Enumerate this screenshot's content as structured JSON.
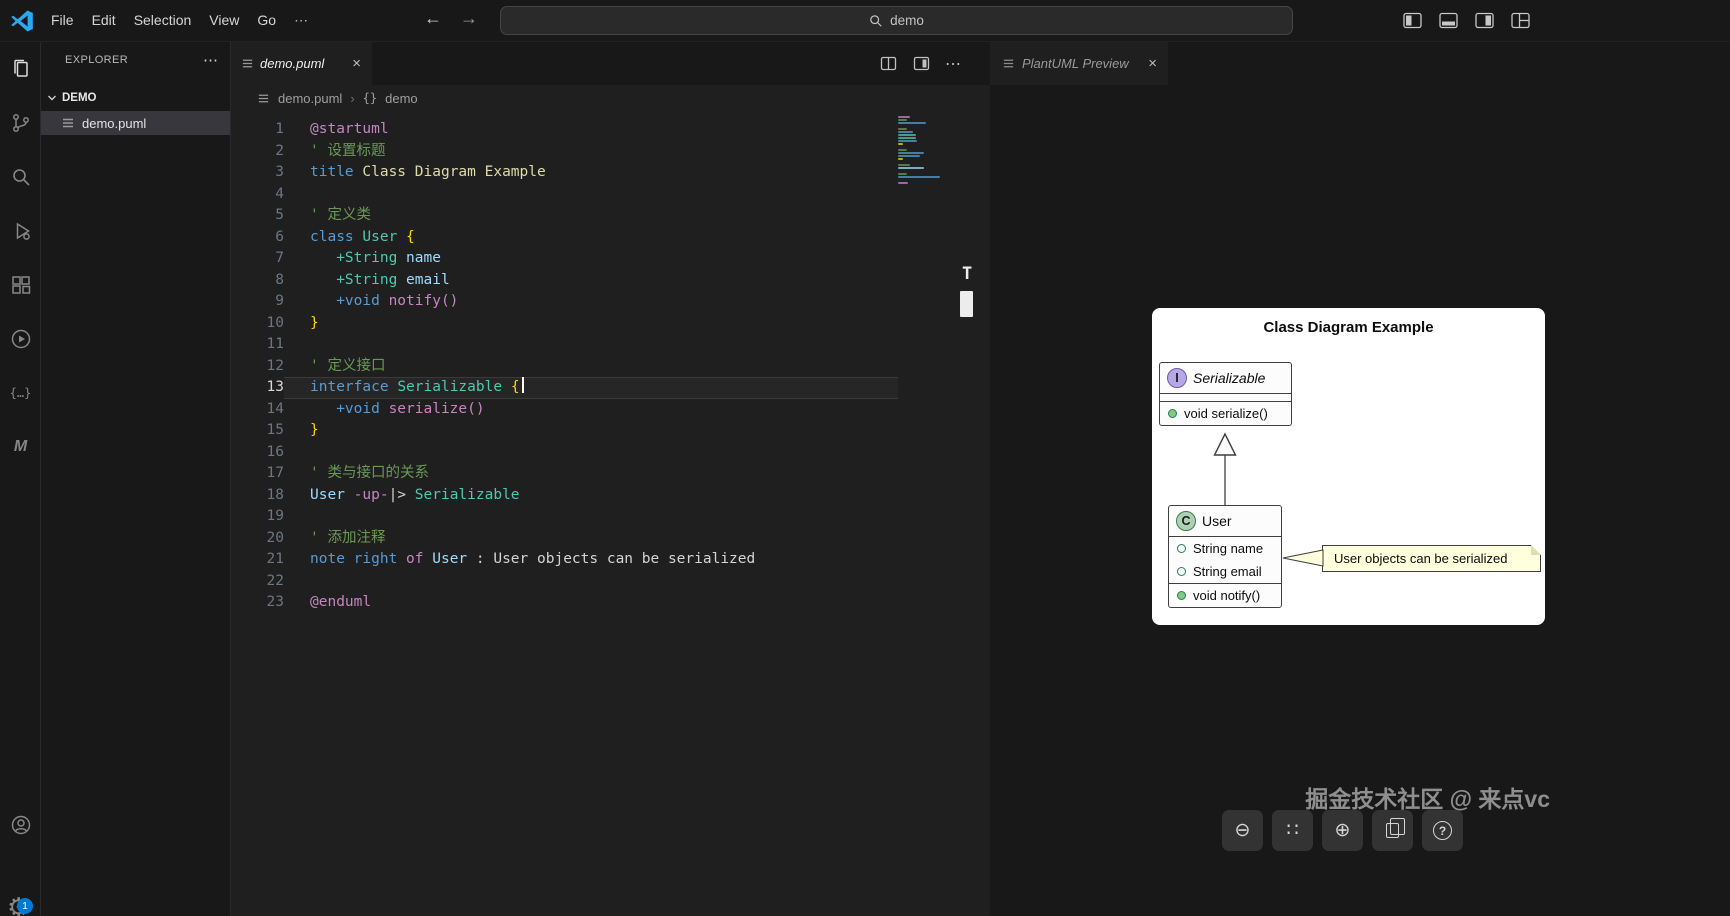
{
  "titlebar": {
    "menus": [
      "File",
      "Edit",
      "Selection",
      "View",
      "Go"
    ],
    "more_glyph": "⋯",
    "back_glyph": "←",
    "forward_glyph": "→",
    "search": {
      "value": "demo"
    },
    "window_icons": [
      "toggle-primary-sidebar",
      "toggle-panel",
      "toggle-secondary-sidebar",
      "customize-layout"
    ]
  },
  "activity_bar": {
    "items": [
      "explorer",
      "source-control",
      "search",
      "run-and-debug",
      "extensions",
      "run-circle",
      "snippets-braces",
      "plantuml-m"
    ],
    "braces_glyph": "{…}",
    "m_glyph": "M",
    "settings_glyph": "⚙",
    "badge": "1"
  },
  "explorer": {
    "title": "EXPLORER",
    "more_glyph": "⋯",
    "section": "DEMO",
    "files": [
      {
        "name": "demo.puml"
      }
    ]
  },
  "editor_group": {
    "tab": {
      "label": "demo.puml",
      "close_glyph": "×"
    },
    "actions_more_glyph": "⋯",
    "breadcrumb": {
      "file": "demo.puml",
      "separator": "›",
      "symbol_glyph": "{}",
      "symbol_name": "demo"
    },
    "overlay_letter": "T"
  },
  "editor": {
    "active_line": 13,
    "token_colors": {
      "pk": "#C586C0",
      "cm": "#6A9955",
      "kw": "#569CD6",
      "ti": "#DCDCAA",
      "ty": "#4EC9B0",
      "vr": "#9CDCFE",
      "fn": "#C586C0",
      "br": "#FFD700",
      "tx": "#D4D4D4"
    },
    "lines": [
      {
        "num": 1,
        "tokens": [
          [
            "pk",
            "@startuml"
          ]
        ]
      },
      {
        "num": 2,
        "tokens": [
          [
            "cm",
            "' 设置标题"
          ]
        ]
      },
      {
        "num": 3,
        "tokens": [
          [
            "kw",
            "title "
          ],
          [
            "ti",
            "Class Diagram Example"
          ]
        ]
      },
      {
        "num": 4,
        "tokens": []
      },
      {
        "num": 5,
        "tokens": [
          [
            "cm",
            "' 定义类"
          ]
        ]
      },
      {
        "num": 6,
        "tokens": [
          [
            "kw",
            "class "
          ],
          [
            "ty",
            "User "
          ],
          [
            "br",
            "{"
          ]
        ]
      },
      {
        "num": 7,
        "tokens": [
          [
            "ty",
            "   +String "
          ],
          [
            "vr",
            "name"
          ]
        ]
      },
      {
        "num": 8,
        "tokens": [
          [
            "ty",
            "   +String "
          ],
          [
            "vr",
            "email"
          ]
        ]
      },
      {
        "num": 9,
        "tokens": [
          [
            "kw",
            "   +void "
          ],
          [
            "fn",
            "notify()"
          ]
        ]
      },
      {
        "num": 10,
        "tokens": [
          [
            "br",
            "}"
          ]
        ]
      },
      {
        "num": 11,
        "tokens": []
      },
      {
        "num": 12,
        "tokens": [
          [
            "cm",
            "' 定义接口"
          ]
        ]
      },
      {
        "num": 13,
        "tokens": [
          [
            "kw",
            "interface "
          ],
          [
            "ty",
            "Serializable "
          ],
          [
            "br",
            "{"
          ],
          [
            "cursor",
            ""
          ]
        ]
      },
      {
        "num": 14,
        "tokens": [
          [
            "kw",
            "   +void "
          ],
          [
            "fn",
            "serialize()"
          ]
        ]
      },
      {
        "num": 15,
        "tokens": [
          [
            "br",
            "}"
          ]
        ]
      },
      {
        "num": 16,
        "tokens": []
      },
      {
        "num": 17,
        "tokens": [
          [
            "cm",
            "' 类与接口的关系"
          ]
        ]
      },
      {
        "num": 18,
        "tokens": [
          [
            "vr",
            "User "
          ],
          [
            "pk",
            "-up-"
          ],
          [
            "tx",
            "|> "
          ],
          [
            "ty",
            "Serializable"
          ]
        ]
      },
      {
        "num": 19,
        "tokens": []
      },
      {
        "num": 20,
        "tokens": [
          [
            "cm",
            "' 添加注释"
          ]
        ]
      },
      {
        "num": 21,
        "tokens": [
          [
            "kw",
            "note right "
          ],
          [
            "pk",
            "of "
          ],
          [
            "vr",
            "User "
          ],
          [
            "tx",
            ": User objects can be serialized"
          ]
        ]
      },
      {
        "num": 22,
        "tokens": []
      },
      {
        "num": 23,
        "tokens": [
          [
            "pk",
            "@enduml"
          ]
        ]
      }
    ]
  },
  "preview": {
    "tab": {
      "label": "PlantUML Preview",
      "close_glyph": "×"
    },
    "watermark": "掘金技术社区 @ 来点vc",
    "toolbar": [
      {
        "name": "zoom-out",
        "glyph": "⊖"
      },
      {
        "name": "move",
        "glyph": "∷"
      },
      {
        "name": "zoom-in",
        "glyph": "⊕"
      },
      {
        "name": "copy",
        "glyph": ""
      },
      {
        "name": "help",
        "glyph": "?"
      }
    ]
  },
  "diagram": {
    "title": "Class Diagram Example",
    "interface": {
      "letter": "I",
      "name": "Serializable",
      "methods": [
        "void serialize()"
      ]
    },
    "class": {
      "letter": "C",
      "name": "User",
      "fields": [
        "String name",
        "String email"
      ],
      "methods": [
        "void notify()"
      ]
    },
    "note": "User objects can be serialized",
    "colors": {
      "interface_icon_bg": "#B6A8E6",
      "class_icon_bg": "#ADD1B2",
      "note_bg": "#FEFFDD",
      "member_green": "#1E8449",
      "border": "#3F3F3F"
    }
  }
}
